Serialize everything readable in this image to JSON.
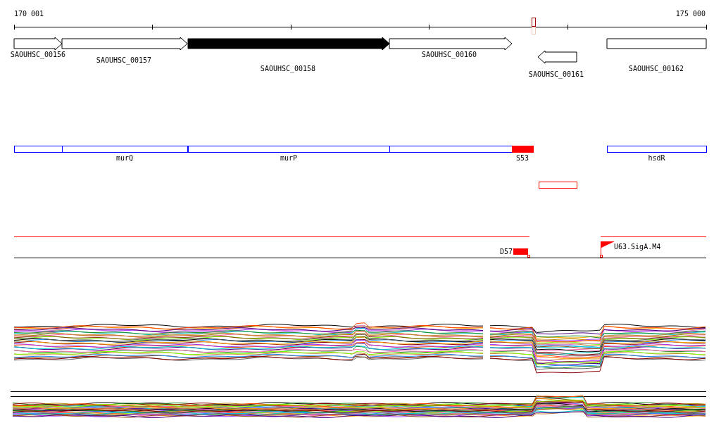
{
  "ruler": {
    "start_label": "170 001",
    "end_label": "175 000"
  },
  "genes": [
    {
      "label": "SAOUHSC_00156",
      "kind": "forward",
      "highlighted": false
    },
    {
      "label": "SAOUHSC_00157",
      "kind": "forward",
      "highlighted": false
    },
    {
      "label": "SAOUHSC_00158",
      "kind": "forward",
      "highlighted": true
    },
    {
      "label": "SAOUHSC_00160",
      "kind": "forward",
      "highlighted": false
    },
    {
      "label": "SAOUHSC_00161",
      "kind": "reverse",
      "highlighted": false
    },
    {
      "label": "SAOUHSC_00162",
      "kind": "plain",
      "highlighted": false
    }
  ],
  "annotations": [
    {
      "color": "#0000ff",
      "filled": false
    },
    {
      "label": "murQ",
      "color": "#0000ff",
      "filled": false
    },
    {
      "label": "murP",
      "color": "#0000ff",
      "filled": false
    },
    {
      "color": "#0000ff",
      "filled": false
    },
    {
      "label": "S53",
      "color": "#ff0000",
      "filled": true
    },
    {
      "label": "hsdR",
      "color": "#0000ff",
      "filled": false
    }
  ],
  "signals": [
    {
      "label": "D57",
      "kind": "block"
    },
    {
      "label": "U63.SigA.M4",
      "kind": "flag"
    }
  ]
}
